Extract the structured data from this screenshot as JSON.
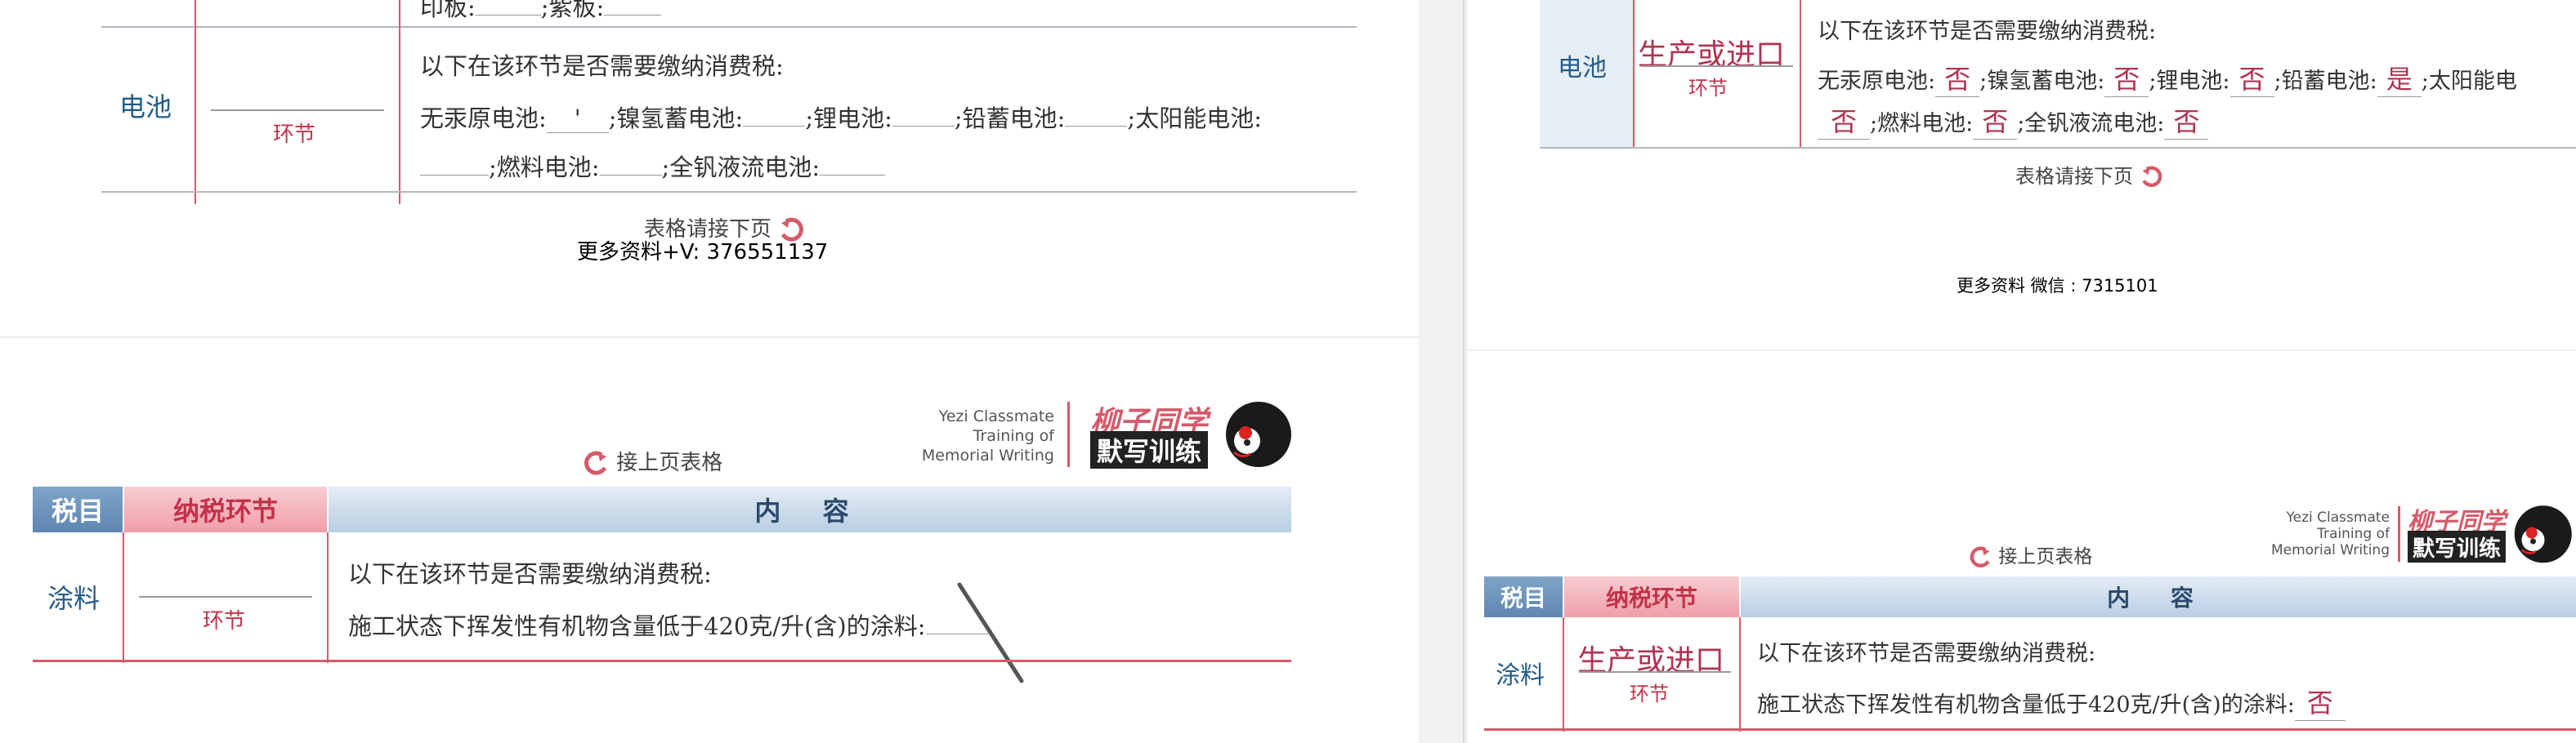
{
  "left": {
    "top_partial_text_a": "印板:",
    "top_partial_text_b": ";紫板:",
    "battery": {
      "tax_item": "电池",
      "stage_label": "环节",
      "question": "以下在该环节是否需要缴纳消费税:",
      "line1": {
        "mercury_free": "无汞原电池:",
        "mercury_free_value": "'",
        "nimh": ";镍氢蓄电池:",
        "lithium": ";锂电池:",
        "lead_acid": ";铅蓄电池:",
        "solar": ";太阳能电池:"
      },
      "line2": {
        "fuel_cell": ";燃料电池:",
        "vanadium": ";全钒液流电池:"
      }
    },
    "continue_next": "表格请接下页",
    "watermark": "更多资料+V:  376551137",
    "brand": {
      "en_line1": "Yezi Classmate",
      "en_line2": "Training of",
      "en_line3": "Memorial Writing",
      "cn_top": "柳子同学",
      "cn_bottom": "默写训练"
    },
    "continue_prev": "接上页表格",
    "header": {
      "col1": "税目",
      "col2": "纳税环节",
      "col3": "内 容"
    },
    "paint": {
      "tax_item": "涂料",
      "stage_label": "环节",
      "question": "以下在该环节是否需要缴纳消费税:",
      "line1": "施工状态下挥发性有机物含量低于420克/升(含)的涂料:"
    }
  },
  "right": {
    "battery": {
      "tax_item": "电池",
      "stage_answer": "生产或进口",
      "stage_label": "环节",
      "question": "以下在该环节是否需要缴纳消费税:",
      "line1": {
        "mercury_free": "无汞原电池:",
        "mercury_free_value": "否",
        "nimh": ";镍氢蓄电池:",
        "nimh_value": "否",
        "lithium": ";锂电池:",
        "lithium_value": "否",
        "lead_acid": ";铅蓄电池:",
        "lead_acid_value": "是",
        "solar": ";太阳能电"
      },
      "line2": {
        "solar_value": "否",
        "fuel_cell": ";燃料电池:",
        "fuel_cell_value": "否",
        "vanadium": ";全钒液流电池:",
        "vanadium_value": "否"
      }
    },
    "continue_next": "表格请接下页",
    "watermark": "更多资料  微信 :  7315101",
    "brand": {
      "en_line1": "Yezi Classmate",
      "en_line2": "Training of",
      "en_line3": "Memorial Writing",
      "cn_top": "柳子同学",
      "cn_bottom": "默写训练"
    },
    "continue_prev": "接上页表格",
    "header": {
      "col1": "税目",
      "col2": "纳税环节",
      "col3": "内 容"
    },
    "paint": {
      "tax_item": "涂料",
      "stage_answer": "生产或进口",
      "stage_label": "环节",
      "question": "以下在该环节是否需要缴纳消费税:",
      "line1": "施工状态下挥发性有机物含量低于420克/升(含)的涂料:",
      "line1_value": "否"
    }
  },
  "colors": {
    "table_red": "#d55a6a",
    "header_blue": "#5e86b0",
    "header_pink": "#ef9ea8",
    "tax_item_text": "#235c8a",
    "handwriting": "#b03350"
  },
  "icons": [
    "continue-arrow-icon",
    "mascot-icon"
  ]
}
